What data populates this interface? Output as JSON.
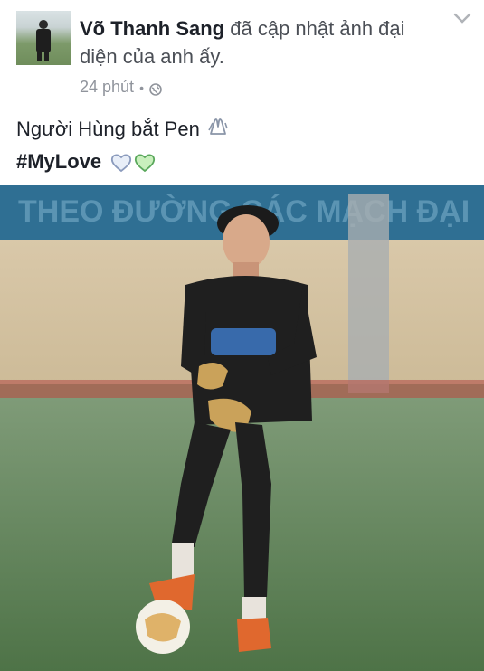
{
  "post": {
    "author_name": "Võ Thanh Sang",
    "action_text": "đã cập nhật ảnh đại diện của anh ấy.",
    "time": "24 phút",
    "separator": "•",
    "privacy_icon": "globe-icon",
    "menu_icon": "chevron-down-icon",
    "caption_line1": "Người Hùng bắt Pen",
    "caption_emoji1": "praying-hands-icon",
    "hashtag": "#MyLove",
    "caption_emoji2": "hearts-icon",
    "colors": {
      "author": "#1d2129",
      "secondary": "#90949c",
      "heart_blue": "#b9c8e6",
      "heart_green": "#b7e3a7"
    }
  },
  "photo": {
    "description_icon": "goalkeeper-photo",
    "banner_text": "THEO ĐƯỜNG CÁC MẠCH ĐẠI"
  }
}
